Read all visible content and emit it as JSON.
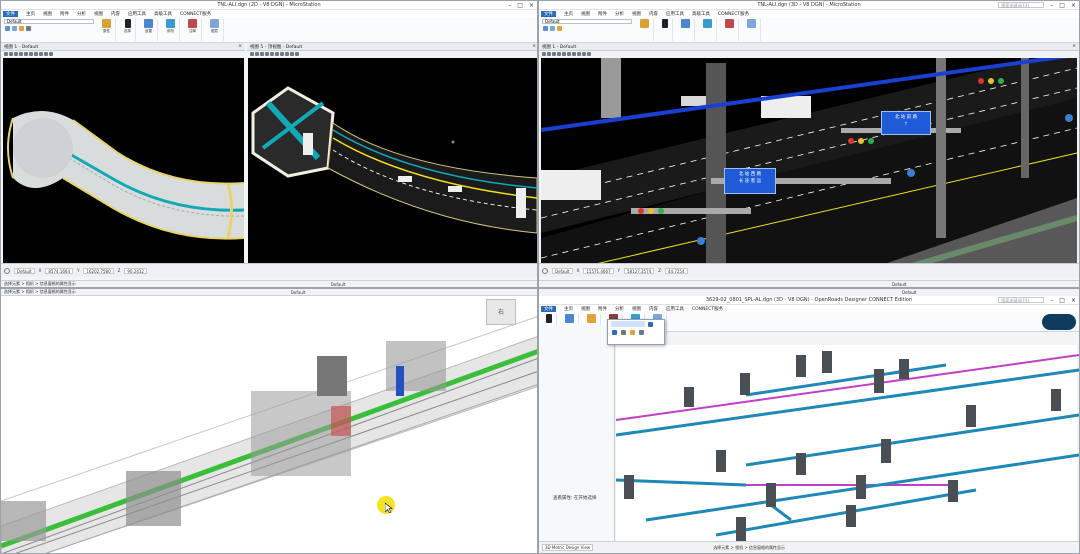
{
  "panes": {
    "tl": {
      "app_title": "TNL-ALI.dgn (2D - V8 DGN) - MicroStation",
      "menu": [
        "文件",
        "主页",
        "视图",
        "附件",
        "分析",
        "视图",
        "内容",
        "Ai",
        "分析",
        "应用工具",
        "高级工具",
        "CONNECT服务"
      ],
      "active_menu": "主页",
      "model_combo": "Default",
      "ribbon_groups": [
        "选择",
        "视图",
        "管理",
        "放置",
        "修改",
        "注释",
        "图层",
        "属性"
      ],
      "view1_title": "视图 1 - Default",
      "view2_title": "视图 5 - 顶视图 - Default",
      "status_model": "Default",
      "coord_x": "X",
      "coord_x_val": "8574.1664",
      "coord_y": "Y",
      "coord_y_val": "16202.7580",
      "coord_z": "Z",
      "coord_z_val": "90.2432",
      "footer_text": "选择元素 > 相机 > 信息窗格的属性显示",
      "footer_model": "Default"
    },
    "tr": {
      "app_title": "TNL-ALI.dgn (3D - V8 DGN) - MicroStation",
      "menu": [
        "文件",
        "主页",
        "视图",
        "附件",
        "分析",
        "视图",
        "内容",
        "Ai",
        "分析",
        "应用工具",
        "高级工具",
        "CONNECT服务"
      ],
      "active_menu": "主页",
      "model_combo": "Default",
      "view_title": "视图 1 - Default",
      "search_placeholder": "搜索关键词(F4)",
      "sign1_line1": "北 站 前 路",
      "sign1_line2": "↑",
      "sign2_line1": "北 站 西 路",
      "sign2_line2": "长 途 客 运",
      "status_model": "Default",
      "coord_x_val": "15571.4667",
      "coord_y_val": "58127.3574",
      "coord_z_val": "44.7254",
      "footer_model": "Default"
    },
    "bl": {
      "footer_text": "选择元素 > 相机 > 信息窗格的属性显示",
      "footer_model": "Default",
      "cube_label": "右"
    },
    "br": {
      "app_title": "3629-02_0801_SPL-AL.dgn (3D - V8 DGN) - OpenRoads Designer CONNECT Edition",
      "menu": [
        "文件",
        "主页",
        "视图",
        "附件",
        "分析",
        "视图",
        "内容",
        "Ai",
        "分析",
        "应用工具",
        "CONNECT服务"
      ],
      "active_menu": "主页",
      "search_placeholder": "搜索关键词(F4)",
      "side_label": "查看属性: 在开始选择",
      "status_model": "3D Metric Design View",
      "footer_text": "选择元素 > 相机 > 信息窗格的属性显示",
      "footer_model": "Default"
    }
  },
  "colors": {
    "ribbon_blue": "#2b6cb8",
    "road_teal": "#12a9b5",
    "pipe_blue": "#1e88b6",
    "pipe_magenta": "#c13fc7",
    "track_green": "#3bbf3b",
    "cursor_yellow": "#f2e21b"
  }
}
